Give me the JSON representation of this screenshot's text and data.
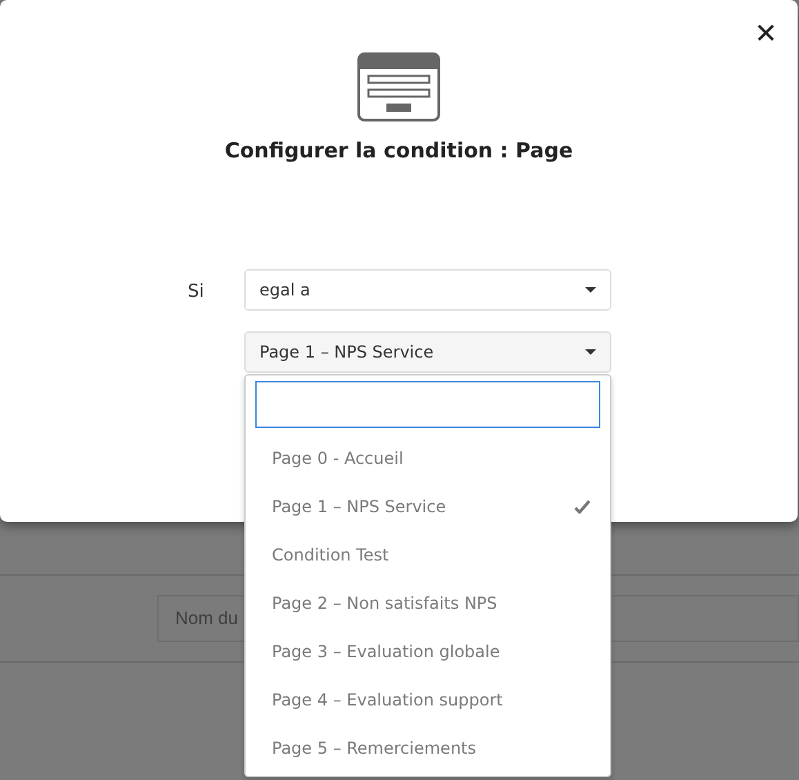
{
  "background": {
    "name_field": {
      "placeholder": "Nom du"
    }
  },
  "dialog": {
    "title": "Configurer la condition : Page",
    "close": "✕",
    "condition_label": "Si",
    "operator": {
      "value": "egal a"
    },
    "page_select": {
      "value": "Page 1 – NPS Service",
      "expanded": true
    },
    "options": [
      {
        "label": "Page 0 - Accueil",
        "selected": false
      },
      {
        "label": "Page 1 – NPS Service",
        "selected": true
      },
      {
        "label": "Condition Test",
        "selected": false
      },
      {
        "label": "Page 2 – Non satisfaits NPS",
        "selected": false
      },
      {
        "label": "Page 3 – Evaluation globale",
        "selected": false
      },
      {
        "label": "Page 4 – Evaluation support",
        "selected": false
      },
      {
        "label": "Page 5 – Remerciements",
        "selected": false
      }
    ]
  }
}
